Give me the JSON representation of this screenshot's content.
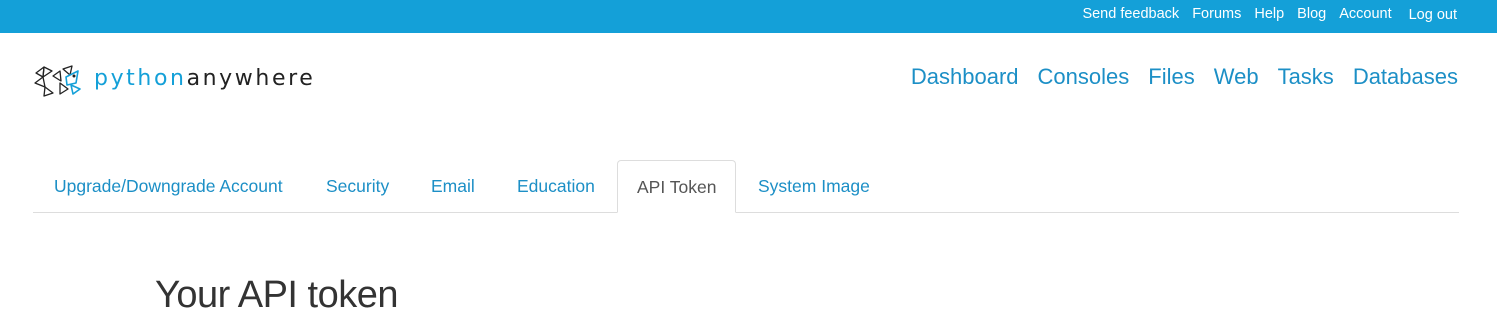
{
  "topbar": {
    "color": "#14a0d8",
    "links": [
      {
        "label": "Send feedback"
      },
      {
        "label": "Forums"
      },
      {
        "label": "Help"
      },
      {
        "label": "Blog"
      },
      {
        "label": "Account"
      },
      {
        "label": "Log out"
      }
    ]
  },
  "logo": {
    "icon": "pythonanywhere-logo-icon",
    "text_part1": "python",
    "text_part2": "anywhere"
  },
  "main_nav": {
    "items": [
      {
        "label": "Dashboard"
      },
      {
        "label": "Consoles"
      },
      {
        "label": "Files"
      },
      {
        "label": "Web"
      },
      {
        "label": "Tasks"
      },
      {
        "label": "Databases"
      }
    ]
  },
  "account_tabs": {
    "items": [
      {
        "label": "Upgrade/Downgrade Account",
        "active": false
      },
      {
        "label": "Security",
        "active": false
      },
      {
        "label": "Email",
        "active": false
      },
      {
        "label": "Education",
        "active": false
      },
      {
        "label": "API Token",
        "active": true
      },
      {
        "label": "System Image",
        "active": false
      }
    ]
  },
  "page": {
    "heading": "Your API token"
  },
  "colors": {
    "accent": "#14a0d8",
    "link": "#1c8fc6",
    "text_dark": "#333333"
  }
}
